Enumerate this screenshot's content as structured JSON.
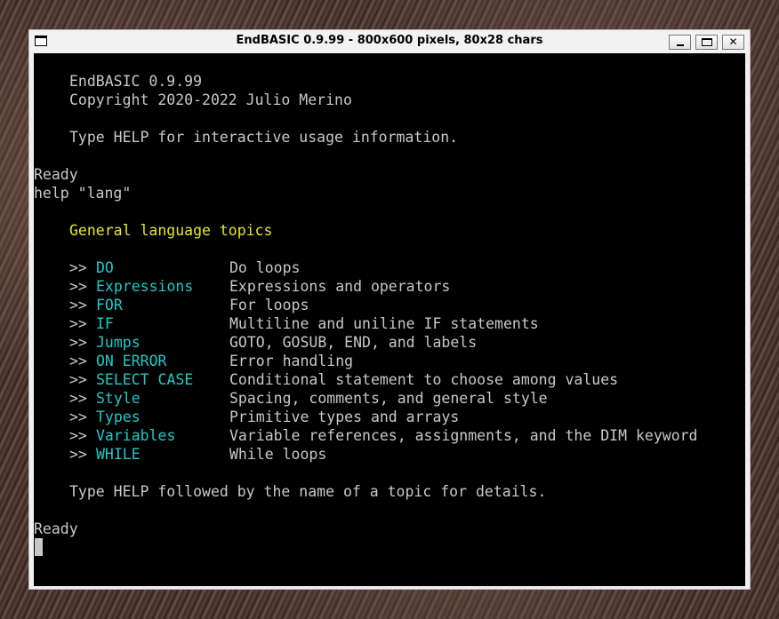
{
  "window": {
    "title": "EndBASIC 0.9.99 - 800x600 pixels, 80x28 chars",
    "minimize_label": "",
    "maximize_label": "",
    "close_label": "✕"
  },
  "console": {
    "banner": "EndBASIC 0.9.99",
    "copyright": "Copyright 2020-2022 Julio Merino",
    "help_hint": "Type HELP for interactive usage information.",
    "ready_1": "Ready",
    "command": "help \"lang\"",
    "section_title": "General language topics",
    "topic_prefix": ">>",
    "topics": [
      {
        "name": "DO",
        "desc": "Do loops"
      },
      {
        "name": "Expressions",
        "desc": "Expressions and operators"
      },
      {
        "name": "FOR",
        "desc": "For loops"
      },
      {
        "name": "IF",
        "desc": "Multiline and uniline IF statements"
      },
      {
        "name": "Jumps",
        "desc": "GOTO, GOSUB, END, and labels"
      },
      {
        "name": "ON ERROR",
        "desc": "Error handling"
      },
      {
        "name": "SELECT CASE",
        "desc": "Conditional statement to choose among values"
      },
      {
        "name": "Style",
        "desc": "Spacing, comments, and general style"
      },
      {
        "name": "Types",
        "desc": "Primitive types and arrays"
      },
      {
        "name": "Variables",
        "desc": "Variable references, assignments, and the DIM keyword"
      },
      {
        "name": "WHILE",
        "desc": "While loops"
      }
    ],
    "footer_hint": "Type HELP followed by the name of a topic for details.",
    "ready_2": "Ready"
  },
  "colors": {
    "text": "#c8c8c8",
    "heading": "#e6e62a",
    "topic": "#22c8c8",
    "background": "#000000"
  }
}
